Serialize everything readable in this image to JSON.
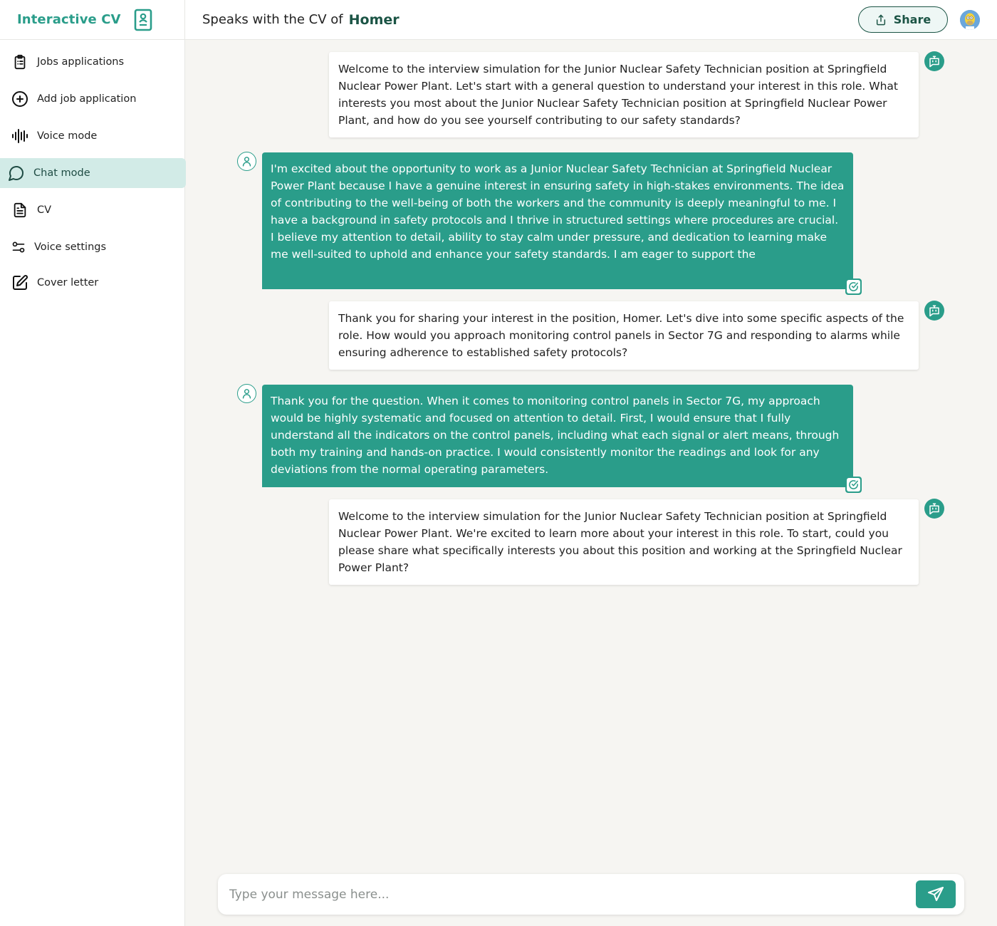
{
  "app": {
    "title": "Interactive CV",
    "brand_icon": "id-badge-icon",
    "accent_color": "#2a9d8a",
    "dark_accent_color": "#1b5445",
    "active_bg_color": "#d2ebe7"
  },
  "sidebar": {
    "items": [
      {
        "label": "Jobs applications",
        "icon": "clipboard-list-icon",
        "active": false
      },
      {
        "label": "Add job application",
        "icon": "plus-circle-icon",
        "active": false
      },
      {
        "label": "Voice mode",
        "icon": "audio-waveform-icon",
        "active": false
      },
      {
        "label": "Chat mode",
        "icon": "chat-bubble-icon",
        "active": true
      },
      {
        "label": "CV",
        "icon": "document-icon",
        "active": false
      },
      {
        "label": "Voice settings",
        "icon": "sliders-icon",
        "active": false
      },
      {
        "label": "Cover letter",
        "icon": "edit-square-icon",
        "active": false
      }
    ]
  },
  "header": {
    "prefix": "Speaks with the CV of",
    "name": "Homer",
    "share_label": "Share",
    "share_icon": "share-upload-icon",
    "avatar": "user-avatar-homer"
  },
  "messages": [
    {
      "role": "bot",
      "text": "Welcome to the interview simulation for the Junior Nuclear Safety Technician position at Springfield Nuclear Power Plant. Let's start with a general question to understand your interest in this role. What interests you most about the Junior Nuclear Safety Technician position at Springfield Nuclear Power Plant, and how do you see yourself contributing to our safety standards?"
    },
    {
      "role": "user",
      "text": "I'm excited about the opportunity to work as a Junior Nuclear Safety Technician at Springfield Nuclear Power Plant because I have a genuine interest in ensuring safety in high-stakes environments. The idea of contributing to the well-being of both the workers and the community is deeply meaningful to me. I have a background in safety protocols and I thrive in structured settings where procedures are crucial. I believe my attention to detail, ability to stay calm under pressure, and dedication to learning make me well-suited to uphold and enhance your safety standards. I am eager to support the"
    },
    {
      "role": "bot",
      "text": "Thank you for sharing your interest in the position, Homer. Let's dive into some specific aspects of the role. How would you approach monitoring control panels in Sector 7G and responding to alarms while ensuring adherence to established safety protocols?"
    },
    {
      "role": "user",
      "text": "Thank you for the question. When it comes to monitoring control panels in Sector 7G, my approach would be highly systematic and focused on attention to detail. First, I would ensure that I fully understand all the indicators on the control panels, including what each signal or alert means, through both my training and hands-on practice. I would consistently monitor the readings and look for any deviations from the normal operating parameters."
    },
    {
      "role": "bot",
      "text": "Welcome to the interview simulation for the Junior Nuclear Safety Technician position at Springfield Nuclear Power Plant. We're excited to learn more about your interest in this role. To start, could you please share what specifically interests you about this position and working at the Springfield Nuclear Power Plant?"
    }
  ],
  "composer": {
    "placeholder": "Type your message here...",
    "value": "",
    "send_icon": "send-paper-plane-icon"
  }
}
